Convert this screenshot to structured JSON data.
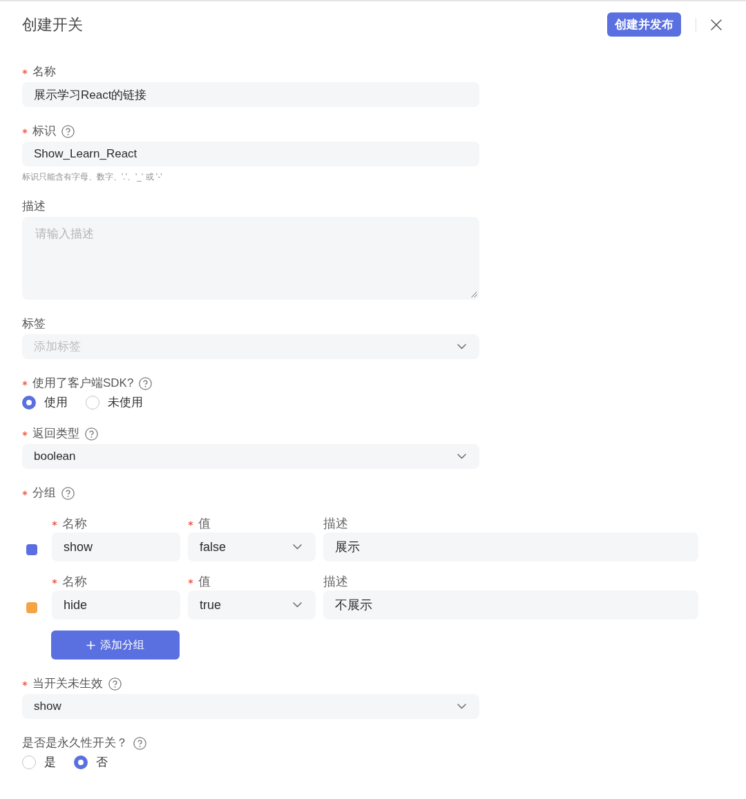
{
  "header": {
    "title": "创建开关",
    "publish_button": "创建并发布"
  },
  "fields": [
    {
      "kind": "input",
      "label": "名称",
      "required": true,
      "help": false,
      "value": "展示学习React的链接"
    },
    {
      "kind": "input",
      "label": "标识",
      "required": true,
      "help": true,
      "value": "Show_Learn_React",
      "hint": "标识只能含有字母、数字、'.'、'_' 或 '-'"
    },
    {
      "kind": "textarea",
      "label": "描述",
      "required": false,
      "help": false,
      "placeholder": "请输入描述"
    },
    {
      "kind": "select",
      "label": "标签",
      "required": false,
      "help": false,
      "placeholder": "添加标签"
    },
    {
      "kind": "radio",
      "label": "使用了客户端SDK?",
      "required": true,
      "help": true,
      "options": [
        {
          "label": "使用",
          "selected": true
        },
        {
          "label": "未使用",
          "selected": false
        }
      ]
    },
    {
      "kind": "select",
      "label": "返回类型",
      "required": true,
      "help": true,
      "value": "boolean"
    },
    {
      "kind": "groups",
      "label": "分组",
      "required": true,
      "help": true,
      "rows": [
        {
          "color": "#5b6ee1",
          "cells": [
            {
              "kind": "input",
              "label": "名称",
              "required": true,
              "value": "show"
            },
            {
              "kind": "select",
              "label": "值",
              "required": true,
              "value": "false"
            },
            {
              "kind": "input",
              "label": "描述",
              "required": false,
              "value": "展示"
            }
          ]
        },
        {
          "color": "#f5a445",
          "cells": [
            {
              "kind": "input",
              "label": "名称",
              "required": true,
              "value": "hide"
            },
            {
              "kind": "select",
              "label": "值",
              "required": true,
              "value": "true"
            },
            {
              "kind": "input",
              "label": "描述",
              "required": false,
              "value": "不展示"
            }
          ]
        }
      ],
      "add_button": "添加分组"
    },
    {
      "kind": "select",
      "label": "当开关未生效",
      "required": true,
      "help": true,
      "value": "show"
    },
    {
      "kind": "radio",
      "label": "是否是永久性开关？",
      "required": false,
      "help": true,
      "options": [
        {
          "label": "是",
          "selected": false
        },
        {
          "label": "否",
          "selected": true
        }
      ]
    }
  ]
}
